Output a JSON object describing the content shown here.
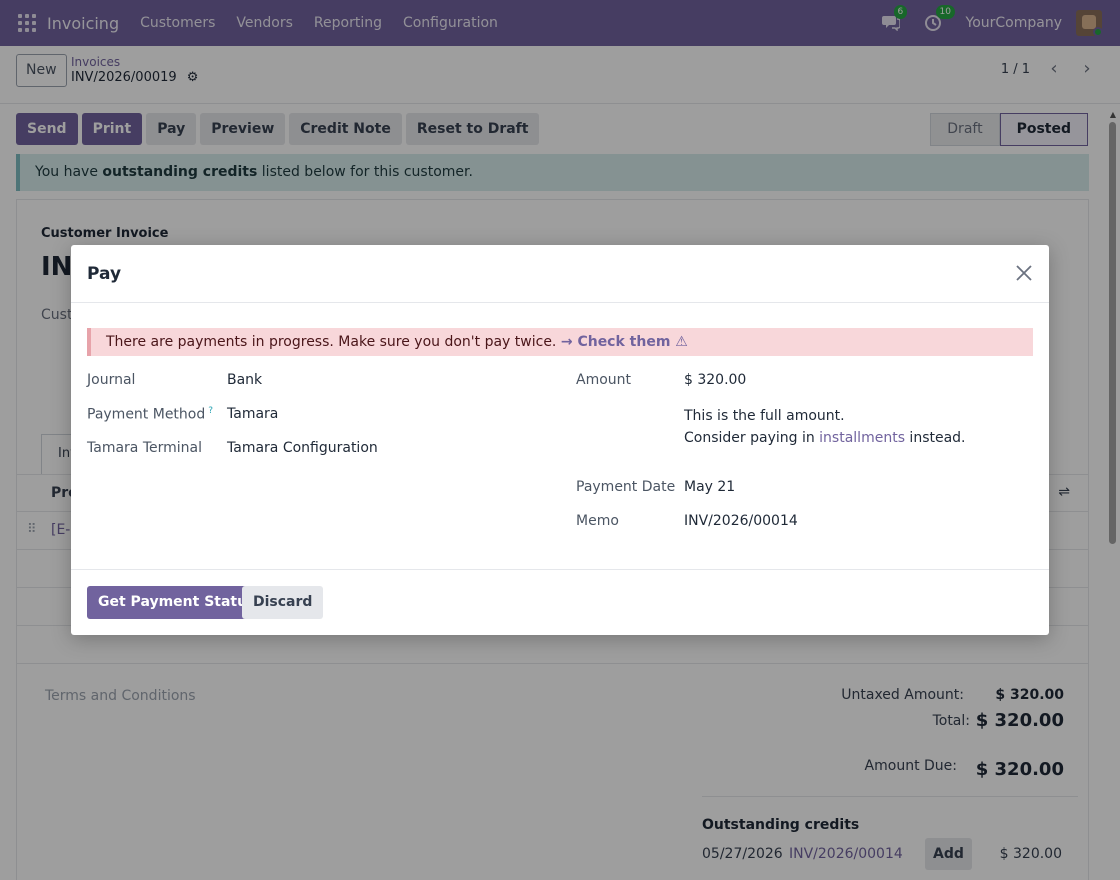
{
  "navbar": {
    "app_name": "Invoicing",
    "menu": [
      "Customers",
      "Vendors",
      "Reporting",
      "Configuration"
    ],
    "messages_count": "6",
    "activities_count": "10",
    "company": "YourCompany"
  },
  "control": {
    "new_label": "New",
    "breadcrumb_parent": "Invoices",
    "breadcrumb_current": "INV/2026/00019",
    "pager": "1 / 1"
  },
  "actions": {
    "send": "Send",
    "print": "Print",
    "pay": "Pay",
    "preview": "Preview",
    "credit_note": "Credit Note",
    "reset": "Reset to Draft"
  },
  "status": {
    "stages": [
      "Draft",
      "Posted"
    ],
    "active": "Posted"
  },
  "info_alert": {
    "before": "You have ",
    "bold": "outstanding credits",
    "after": " listed below for this customer."
  },
  "sheet": {
    "label": "Customer Invoice",
    "name_partial": "INV",
    "customer_label_partial": "Cust",
    "tab_partial": "Inv",
    "col_product_partial": "Pro",
    "row_partial": "[E-C",
    "terms_placeholder": "Terms and Conditions",
    "untaxed_label": "Untaxed Amount:",
    "untaxed_value": "$ 320.00",
    "total_label": "Total:",
    "total_value": "$ 320.00",
    "due_label": "Amount Due:",
    "due_value": "$ 320.00",
    "outstanding_title": "Outstanding credits",
    "credit": {
      "date": "05/27/2026",
      "ref": "INV/2026/00014",
      "add_label": "Add",
      "amount": "$ 320.00"
    }
  },
  "modal": {
    "title": "Pay",
    "warning": "There are payments in progress. Make sure you don't pay twice.",
    "warning_link": "→ Check them",
    "journal_label": "Journal",
    "journal_value": "Bank",
    "method_label": "Payment Method",
    "method_help": "?",
    "method_value": "Tamara",
    "terminal_label": "Tamara Terminal",
    "terminal_value": "Tamara Configuration",
    "amount_label": "Amount",
    "amount_value": "$ 320.00",
    "note_line1": "This is the full amount.",
    "note_line2_before": "Consider paying in ",
    "note_link": "installments",
    "note_line2_after": " instead.",
    "date_label": "Payment Date",
    "date_value": "May 21",
    "memo_label": "Memo",
    "memo_value": "INV/2026/00014",
    "primary_button": "Get Payment Status",
    "discard_button": "Discard"
  },
  "colors": {
    "brand": "#71639e",
    "info_bg": "#d7ecec",
    "danger_bg": "#f8d7da"
  }
}
